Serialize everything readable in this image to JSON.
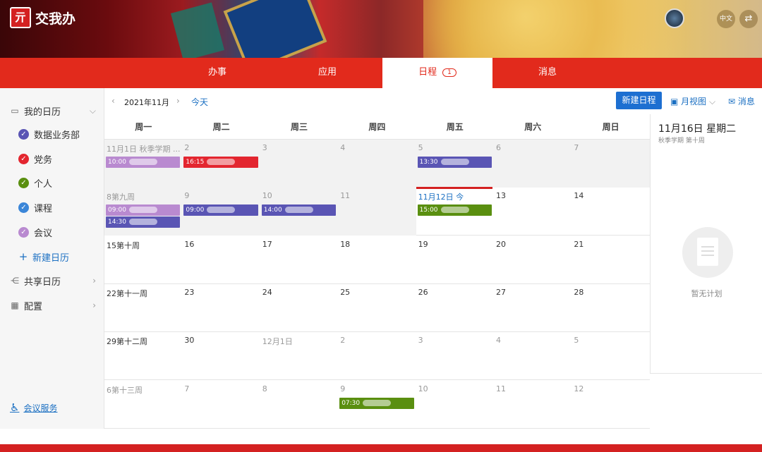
{
  "brand": {
    "logo_mark": "亓",
    "name": "交我办"
  },
  "header": {
    "lang": "中文",
    "swap": "⇄"
  },
  "tabs": [
    {
      "label": "办事",
      "active": false
    },
    {
      "label": "应用",
      "active": false
    },
    {
      "label": "日程",
      "active": true,
      "badge": "1"
    },
    {
      "label": "消息",
      "active": false
    }
  ],
  "sidebar": {
    "my_calendar": "我的日历",
    "calendars": [
      {
        "label": "数据业务部",
        "color": "#5a55b4"
      },
      {
        "label": "党务",
        "color": "#e3262f"
      },
      {
        "label": "个人",
        "color": "#5a8f10"
      },
      {
        "label": "课程",
        "color": "#3b86d8"
      },
      {
        "label": "会议",
        "color": "#b98ad0"
      }
    ],
    "new_calendar": "新建日历",
    "shared_calendar": "共享日历",
    "config": "配置",
    "meeting_service": "会议服务"
  },
  "toolbar": {
    "month": "2021年11月",
    "today": "今天",
    "new_event": "新建日程",
    "view": "月视图",
    "messages": "消息"
  },
  "weekdays": [
    "周一",
    "周二",
    "周三",
    "周四",
    "周五",
    "周六",
    "周日"
  ],
  "weeks": [
    {
      "days": [
        {
          "label": "11月1日 秋季学期 ...",
          "grey": true,
          "muted": true
        },
        {
          "label": "2",
          "grey": true,
          "muted": true
        },
        {
          "label": "3",
          "grey": true,
          "muted": true
        },
        {
          "label": "4",
          "grey": true,
          "muted": true
        },
        {
          "label": "5",
          "grey": true,
          "muted": true
        },
        {
          "label": "6",
          "grey": true,
          "muted": true
        },
        {
          "label": "7",
          "grey": true,
          "muted": true
        }
      ],
      "events": [
        {
          "day": 0,
          "slot": 0,
          "text": "10:00",
          "color": "#b98ad0"
        },
        {
          "day": 1,
          "slot": 0,
          "text": "16:15",
          "color": "#e3262f"
        },
        {
          "day": 4,
          "slot": 0,
          "text": "13:30",
          "color": "#5a55b4"
        }
      ]
    },
    {
      "days": [
        {
          "label": "8第九周",
          "grey": true,
          "muted": true
        },
        {
          "label": "9",
          "grey": true,
          "muted": true
        },
        {
          "label": "10",
          "grey": true,
          "muted": true
        },
        {
          "label": "11",
          "grey": true,
          "muted": true
        },
        {
          "label": "11月12日 今",
          "grey": false,
          "today": true
        },
        {
          "label": "13",
          "grey": false
        },
        {
          "label": "14",
          "grey": false
        }
      ],
      "events": [
        {
          "day": 0,
          "slot": 0,
          "text": "09:00",
          "color": "#b98ad0"
        },
        {
          "day": 0,
          "slot": 1,
          "text": "14:30",
          "color": "#5a55b4"
        },
        {
          "day": 1,
          "slot": 0,
          "text": "09:00",
          "color": "#5a55b4"
        },
        {
          "day": 2,
          "slot": 0,
          "text": "14:00",
          "color": "#5a55b4"
        },
        {
          "day": 4,
          "slot": 0,
          "text": "15:00",
          "color": "#5a8f10"
        }
      ]
    },
    {
      "days": [
        {
          "label": "15第十周"
        },
        {
          "label": "16"
        },
        {
          "label": "17"
        },
        {
          "label": "18"
        },
        {
          "label": "19"
        },
        {
          "label": "20"
        },
        {
          "label": "21"
        }
      ],
      "events": []
    },
    {
      "days": [
        {
          "label": "22第十一周"
        },
        {
          "label": "23"
        },
        {
          "label": "24"
        },
        {
          "label": "25"
        },
        {
          "label": "26"
        },
        {
          "label": "27"
        },
        {
          "label": "28"
        }
      ],
      "events": []
    },
    {
      "days": [
        {
          "label": "29第十二周"
        },
        {
          "label": "30"
        },
        {
          "label": "12月1日",
          "muted": true
        },
        {
          "label": "2",
          "muted": true
        },
        {
          "label": "3",
          "muted": true
        },
        {
          "label": "4",
          "muted": true
        },
        {
          "label": "5",
          "muted": true
        }
      ],
      "events": []
    },
    {
      "days": [
        {
          "label": "6第十三周",
          "muted": true
        },
        {
          "label": "7",
          "muted": true
        },
        {
          "label": "8",
          "muted": true
        },
        {
          "label": "9",
          "muted": true
        },
        {
          "label": "10",
          "muted": true
        },
        {
          "label": "11",
          "muted": true
        },
        {
          "label": "12",
          "muted": true
        }
      ],
      "events": [
        {
          "day": 3,
          "slot": 0,
          "text": "07:30",
          "color": "#5a8f10"
        }
      ]
    }
  ],
  "right_panel": {
    "date": "11月16日 星期二",
    "subtitle": "秋季学期 第十周",
    "empty": "暂无计划"
  }
}
